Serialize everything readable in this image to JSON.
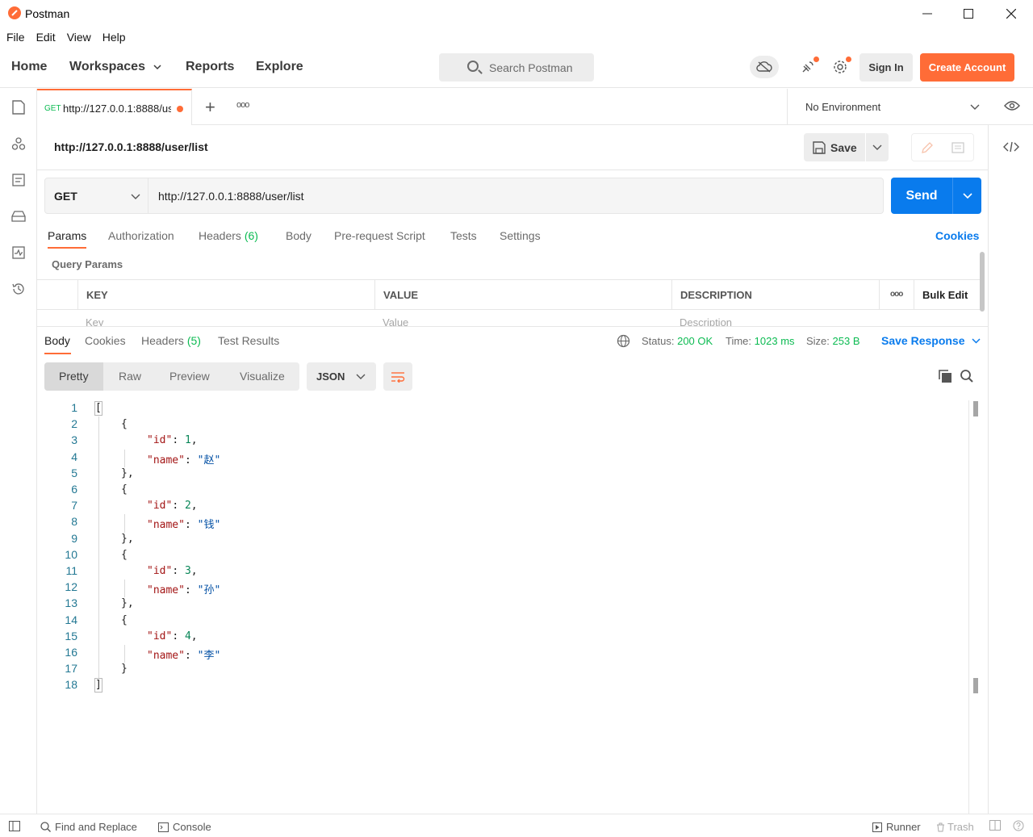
{
  "window": {
    "title": "Postman",
    "minimize": "—",
    "maximize": "☐",
    "close": "✕"
  },
  "menu": [
    "File",
    "Edit",
    "View",
    "Help"
  ],
  "header": {
    "nav": [
      "Home",
      "Workspaces",
      "Reports",
      "Explore"
    ],
    "search_placeholder": "Search Postman",
    "sign_in": "Sign In",
    "create_account": "Create Account"
  },
  "tab": {
    "method": "GET",
    "url": "http://127.0.0.1:8888/us",
    "new_tab": "+",
    "more": "ooo"
  },
  "environment": {
    "label": "No Environment"
  },
  "request": {
    "title": "http://127.0.0.1:8888/user/list",
    "save_label": "Save",
    "method": "GET",
    "url": "http://127.0.0.1:8888/user/list",
    "send_label": "Send",
    "tabs": [
      "Params",
      "Authorization",
      "Headers",
      "Body",
      "Pre-request Script",
      "Tests",
      "Settings"
    ],
    "headers_count": "(6)",
    "cookies_label": "Cookies",
    "query_params_label": "Query Params",
    "table": {
      "headers": [
        "KEY",
        "VALUE",
        "DESCRIPTION"
      ],
      "more": "ooo",
      "bulk_edit": "Bulk Edit",
      "placeholders": [
        "Key",
        "Value",
        "Description"
      ]
    }
  },
  "response": {
    "tabs": [
      "Body",
      "Cookies",
      "Headers",
      "Test Results"
    ],
    "headers_count": "(5)",
    "status_label": "Status:",
    "status_value": "200 OK",
    "time_label": "Time:",
    "time_value": "1023 ms",
    "size_label": "Size:",
    "size_value": "253 B",
    "save_response": "Save Response",
    "views": [
      "Pretty",
      "Raw",
      "Preview",
      "Visualize"
    ],
    "format": "JSON",
    "body_lines": [
      {
        "n": "1",
        "indent": 0,
        "parts": [
          [
            "p",
            "["
          ]
        ]
      },
      {
        "n": "2",
        "indent": 1,
        "parts": [
          [
            "p",
            "{"
          ]
        ]
      },
      {
        "n": "3",
        "indent": 2,
        "parts": [
          [
            "k",
            "\"id\""
          ],
          [
            "p",
            ": "
          ],
          [
            "n",
            "1"
          ],
          [
            "p",
            ","
          ]
        ]
      },
      {
        "n": "4",
        "indent": 2,
        "parts": [
          [
            "k",
            "\"name\""
          ],
          [
            "p",
            ": "
          ],
          [
            "s",
            "\"赵\""
          ]
        ]
      },
      {
        "n": "5",
        "indent": 1,
        "parts": [
          [
            "p",
            "},"
          ]
        ]
      },
      {
        "n": "6",
        "indent": 1,
        "parts": [
          [
            "p",
            "{"
          ]
        ]
      },
      {
        "n": "7",
        "indent": 2,
        "parts": [
          [
            "k",
            "\"id\""
          ],
          [
            "p",
            ": "
          ],
          [
            "n",
            "2"
          ],
          [
            "p",
            ","
          ]
        ]
      },
      {
        "n": "8",
        "indent": 2,
        "parts": [
          [
            "k",
            "\"name\""
          ],
          [
            "p",
            ": "
          ],
          [
            "s",
            "\"钱\""
          ]
        ]
      },
      {
        "n": "9",
        "indent": 1,
        "parts": [
          [
            "p",
            "},"
          ]
        ]
      },
      {
        "n": "10",
        "indent": 1,
        "parts": [
          [
            "p",
            "{"
          ]
        ]
      },
      {
        "n": "11",
        "indent": 2,
        "parts": [
          [
            "k",
            "\"id\""
          ],
          [
            "p",
            ": "
          ],
          [
            "n",
            "3"
          ],
          [
            "p",
            ","
          ]
        ]
      },
      {
        "n": "12",
        "indent": 2,
        "parts": [
          [
            "k",
            "\"name\""
          ],
          [
            "p",
            ": "
          ],
          [
            "s",
            "\"孙\""
          ]
        ]
      },
      {
        "n": "13",
        "indent": 1,
        "parts": [
          [
            "p",
            "},"
          ]
        ]
      },
      {
        "n": "14",
        "indent": 1,
        "parts": [
          [
            "p",
            "{"
          ]
        ]
      },
      {
        "n": "15",
        "indent": 2,
        "parts": [
          [
            "k",
            "\"id\""
          ],
          [
            "p",
            ": "
          ],
          [
            "n",
            "4"
          ],
          [
            "p",
            ","
          ]
        ]
      },
      {
        "n": "16",
        "indent": 2,
        "parts": [
          [
            "k",
            "\"name\""
          ],
          [
            "p",
            ": "
          ],
          [
            "s",
            "\"李\""
          ]
        ]
      },
      {
        "n": "17",
        "indent": 1,
        "parts": [
          [
            "p",
            "}"
          ]
        ]
      },
      {
        "n": "18",
        "indent": 0,
        "parts": [
          [
            "p",
            "]"
          ]
        ]
      }
    ]
  },
  "statusbar": {
    "find_replace": "Find and Replace",
    "console": "Console",
    "runner": "Runner",
    "trash": "Trash"
  },
  "colors": {
    "accent": "#ff6c37",
    "primary": "#097bed",
    "success": "#0cbb52"
  }
}
